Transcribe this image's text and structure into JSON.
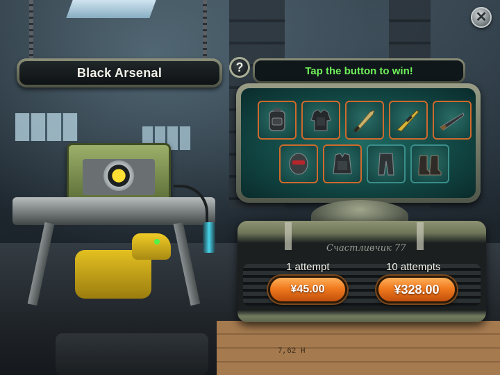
{
  "title": "Black Arsenal",
  "header_message": "Tap the button to win!",
  "help_label": "?",
  "close_label": "✕",
  "stencil_text": "Счастливчик 77",
  "crate_text": "7,62 Н",
  "rewards": [
    {
      "name": "backpack-icon",
      "rarity": "orange"
    },
    {
      "name": "tactical-jacket-icon",
      "rarity": "orange"
    },
    {
      "name": "machete-icon",
      "rarity": "orange"
    },
    {
      "name": "sniper-rifle-icon",
      "rarity": "orange"
    },
    {
      "name": "shotgun-icon",
      "rarity": "orange"
    },
    {
      "name": "combat-helmet-icon",
      "rarity": "orange"
    },
    {
      "name": "armored-vest-icon",
      "rarity": "orange"
    },
    {
      "name": "combat-pants-icon",
      "rarity": "blue"
    },
    {
      "name": "combat-boots-icon",
      "rarity": "blue"
    }
  ],
  "purchase": {
    "single": {
      "label": "1 attempt",
      "price": "¥45.00"
    },
    "multi": {
      "label": "10 attempts",
      "price": "¥328.00"
    }
  },
  "colors": {
    "accent_green": "#6ef25a",
    "button_orange": "#f07a1e",
    "rarity_orange": "#cf6a2c",
    "rarity_blue": "#3b8f8a"
  }
}
